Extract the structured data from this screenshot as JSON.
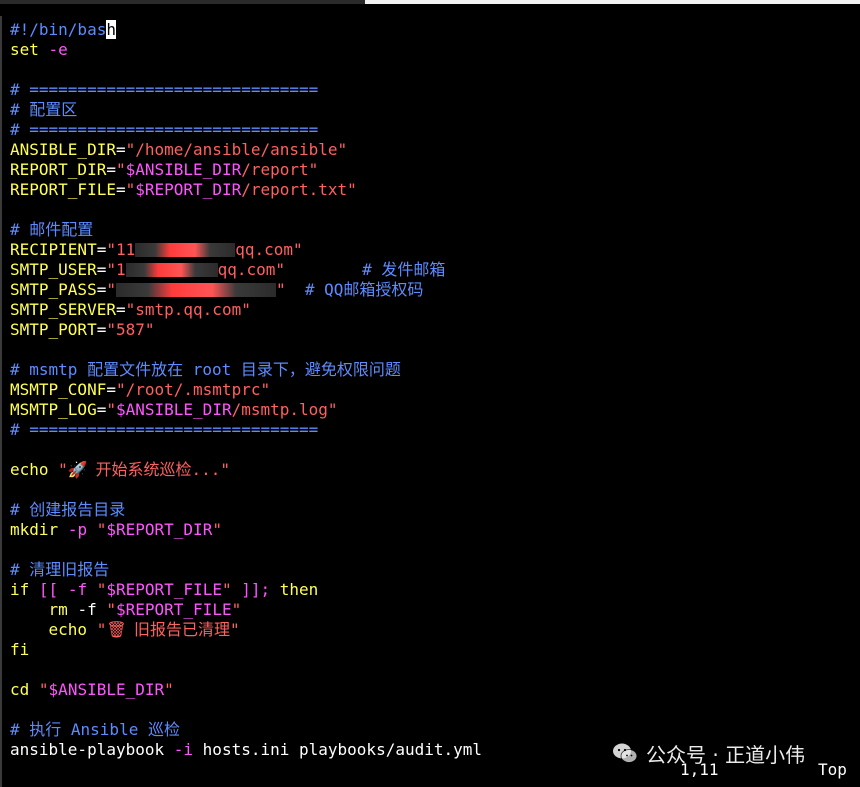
{
  "script": {
    "shebang": "#!/bin/bas",
    "shebang_cursor_char": "h",
    "set_cmd": "set",
    "set_flag": "-e",
    "sep": "# ==============================",
    "config_title": "# 配置区",
    "ansible_dir_name": "ANSIBLE_DIR",
    "ansible_dir_value": "\"/home/ansible/ansible\"",
    "report_dir_name": "REPORT_DIR",
    "report_dir_var": "$ANSIBLE_DIR",
    "report_dir_suffix": "/report\"",
    "report_file_name": "REPORT_FILE",
    "report_file_var": "$REPORT_DIR",
    "report_file_suffix": "/report.txt\"",
    "mail_title": "# 邮件配置",
    "recipient_name": "RECIPIENT",
    "recipient_prefix": "\"11",
    "recipient_suffix": "qq.com\"",
    "smtp_user_name": "SMTP_USER",
    "smtp_user_prefix": "\"1",
    "smtp_user_suffix": "qq.com\"",
    "smtp_user_comment": "# 发件邮箱",
    "smtp_pass_name": "SMTP_PASS",
    "smtp_pass_prefix": "\"",
    "smtp_pass_suffix": "\"",
    "smtp_pass_comment": "# QQ邮箱授权码",
    "smtp_server_name": "SMTP_SERVER",
    "smtp_server_value": "\"smtp.qq.com\"",
    "smtp_port_name": "SMTP_PORT",
    "smtp_port_value": "\"587\"",
    "msmtp_comment": "# msmtp 配置文件放在 root 目录下，避免权限问题",
    "msmtp_conf_name": "MSMTP_CONF",
    "msmtp_conf_value": "\"/root/.msmtprc\"",
    "msmtp_log_name": "MSMTP_LOG",
    "msmtp_log_var": "$ANSIBLE_DIR",
    "msmtp_log_suffix": "/msmtp.log\"",
    "echo_cmd": "echo",
    "echo_start_open": "\"",
    "echo_start_icon": "🚀",
    "echo_start_text": " 开始系统巡检...\"",
    "mkdir_comment": "# 创建报告目录",
    "mkdir_cmd": "mkdir",
    "mkdir_flag": "-p",
    "mkdir_var": "$REPORT_DIR",
    "clean_comment": "# 清理旧报告",
    "if_kw": "if",
    "if_open": "[[",
    "if_flag": "-f",
    "if_var": "$REPORT_FILE",
    "if_close": "]];",
    "then_kw": "then",
    "rm_cmd": "rm",
    "rm_flag": "-f",
    "rm_var": "$REPORT_FILE",
    "echo2_cmd": "echo",
    "echo2_icon": "🗑",
    "echo2_text": " 旧报告已清理\"",
    "fi_kw": "fi",
    "cd_cmd": "cd",
    "cd_var": "$ANSIBLE_DIR",
    "run_comment": "# 执行 Ansible 巡检",
    "playbook_cmd": "ansible-playbook",
    "playbook_flag": "-i",
    "playbook_args": "hosts.ini playbooks/audit.yml"
  },
  "status": {
    "position": "1,11",
    "scroll": "Top"
  },
  "watermark": {
    "text": "公众号 · 正道小伟",
    "icon": "wechat-icon"
  },
  "colors": {
    "background": "#000000",
    "keyword": "#ffff55",
    "variable": "#ff55ff",
    "string": "#ff6060",
    "comment": "#5c8cff"
  }
}
